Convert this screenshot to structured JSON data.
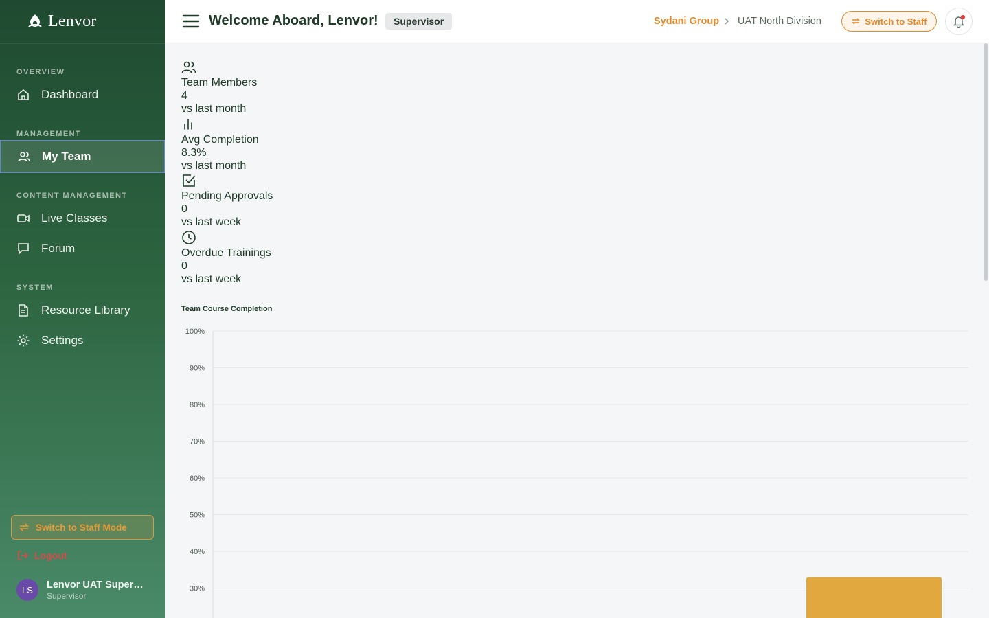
{
  "brand": {
    "name": "Lenvor"
  },
  "sidebar": {
    "sections": [
      {
        "label": "OVERVIEW",
        "items": [
          {
            "label": "Dashboard",
            "icon": "home-icon"
          }
        ]
      },
      {
        "label": "MANAGEMENT",
        "items": [
          {
            "label": "My Team",
            "icon": "users-icon",
            "active": true
          }
        ]
      },
      {
        "label": "CONTENT MANAGEMENT",
        "items": [
          {
            "label": "Live Classes",
            "icon": "video-icon"
          },
          {
            "label": "Forum",
            "icon": "chat-icon"
          }
        ]
      },
      {
        "label": "SYSTEM",
        "items": [
          {
            "label": "Resource Library",
            "icon": "document-icon"
          },
          {
            "label": "Settings",
            "icon": "gear-icon"
          }
        ]
      }
    ],
    "switch_mode_label": "Switch to Staff Mode",
    "logout_label": "Logout",
    "user": {
      "initials": "LS",
      "name": "Lenvor UAT Supervi...",
      "role": "Supervisor"
    }
  },
  "header": {
    "welcome": "Welcome Aboard, Lenvor!",
    "role_badge": "Supervisor",
    "breadcrumb": {
      "org": "Sydani Group",
      "division": "UAT North Division"
    },
    "switch_label": "Switch to Staff"
  },
  "stats": [
    {
      "icon": "users-icon",
      "label": "Team Members",
      "value": "4",
      "compare": "vs last month"
    },
    {
      "icon": "bar-chart-icon",
      "label": "Avg Completion",
      "value": "8.3%",
      "compare": "vs last month"
    },
    {
      "icon": "check-square-icon",
      "label": "Pending Approvals",
      "value": "0",
      "compare": "vs last week"
    },
    {
      "icon": "clock-icon",
      "label": "Overdue Trainings",
      "value": "0",
      "compare": "vs last week"
    }
  ],
  "colors": {
    "accent": "#e58a2a",
    "bar": "#e0a83f",
    "sidebar_top": "#1f4a31"
  },
  "chart_data": {
    "type": "bar",
    "title": "Team Course Completion",
    "y_ticks": [
      "100%",
      "90%",
      "80%",
      "70%",
      "60%",
      "50%",
      "40%",
      "30%"
    ],
    "ylim": [
      0,
      100
    ],
    "grid": true,
    "visible_bars": [
      {
        "value": 33,
        "note_visible": "bar top only, rest cut off"
      }
    ]
  }
}
